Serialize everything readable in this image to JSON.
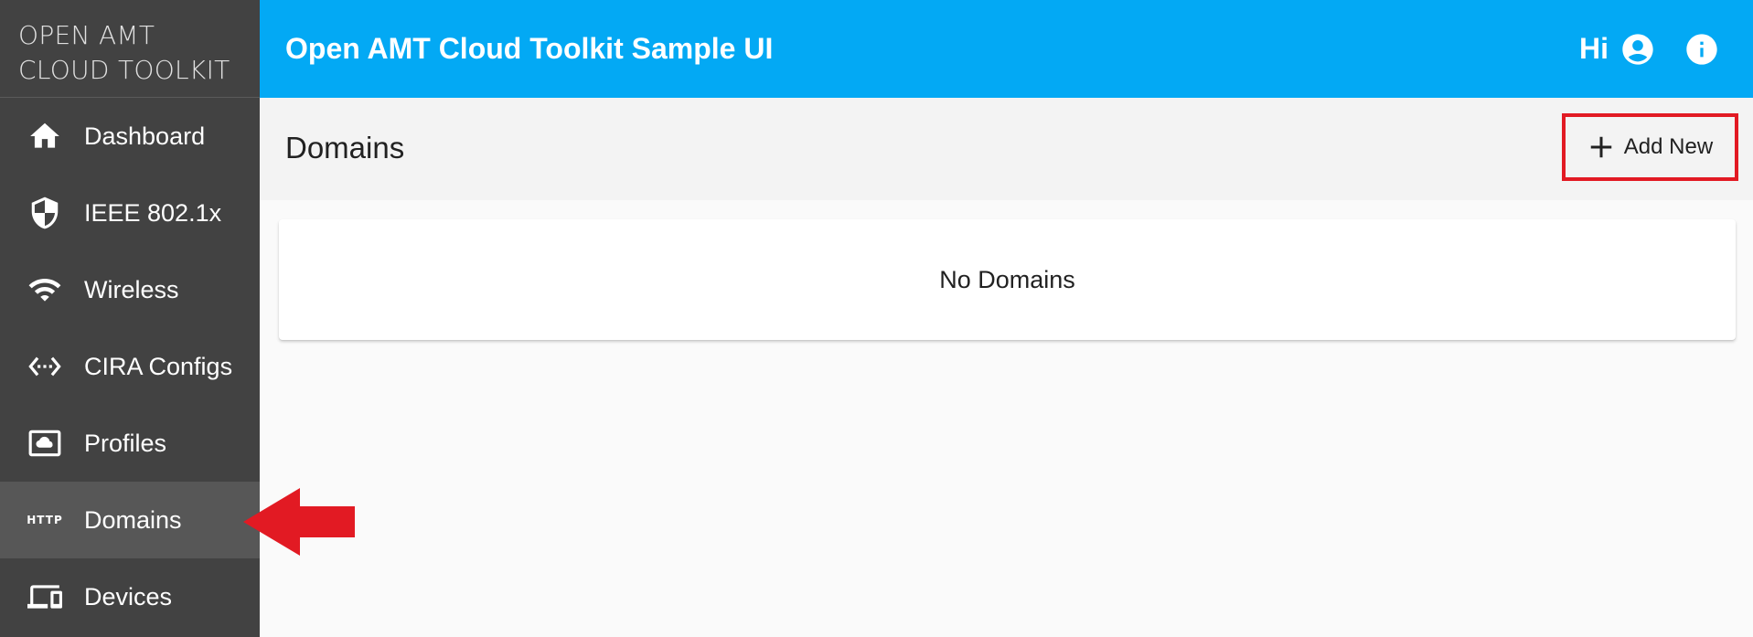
{
  "brand": {
    "line1": "OPEN AMT",
    "line2": "CLOUD TOOLKIT"
  },
  "header": {
    "title": "Open AMT Cloud Toolkit Sample UI",
    "greeting": "Hi"
  },
  "sidebar": {
    "items": [
      {
        "label": "Dashboard",
        "icon": "home-icon",
        "active": false
      },
      {
        "label": "IEEE 802.1x",
        "icon": "shield-icon",
        "active": false
      },
      {
        "label": "Wireless",
        "icon": "wifi-icon",
        "active": false
      },
      {
        "label": "CIRA Configs",
        "icon": "settings-ethernet-icon",
        "active": false
      },
      {
        "label": "Profiles",
        "icon": "cloud-box-icon",
        "active": false
      },
      {
        "label": "Domains",
        "icon": "http-icon",
        "icon_text": "HTTP",
        "active": true
      },
      {
        "label": "Devices",
        "icon": "devices-icon",
        "active": false
      }
    ]
  },
  "main": {
    "page_title": "Domains",
    "add_button_label": "Add New",
    "empty_message": "No Domains"
  },
  "colors": {
    "topbar": "#03a9f4",
    "sidebar": "#424242",
    "sidebar_active": "#575757",
    "annotation_red": "#e21a23"
  }
}
